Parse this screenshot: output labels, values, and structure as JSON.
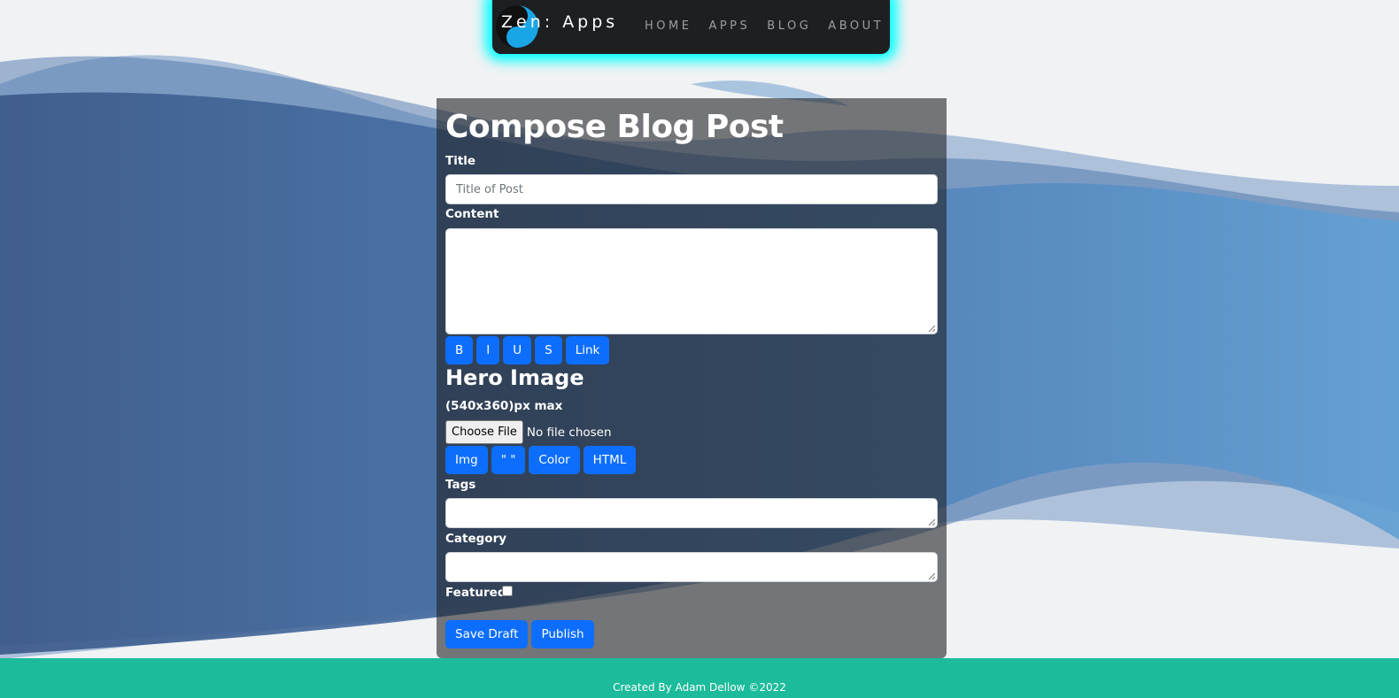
{
  "colors": {
    "page_bg": "#f0f2f4",
    "wave_dark": "#3c5b8c",
    "wave_light": "#5f96c9",
    "navbar_bg": "#1e1f21",
    "navbar_glow": "#00ffff",
    "panel_bg": "rgba(32,34,37,0.6)",
    "button_primary": "#0d6efd",
    "footer_bg": "#1cbb9b"
  },
  "navbar": {
    "brand": "Zen: Apps",
    "logo_icon": "yin-yang-icon",
    "links": [
      "HOME",
      "APPS",
      "BLOG",
      "ABOUT"
    ]
  },
  "form": {
    "heading": "Compose Blog Post",
    "title_label": "Title",
    "title_placeholder": "Title of Post",
    "content_label": "Content",
    "format_buttons": [
      "B",
      "I",
      "U",
      "S",
      "Link"
    ],
    "hero_heading": "Hero Image",
    "hero_size_note": "(540x360)px max",
    "file_button": "Choose File",
    "file_status": "No file chosen",
    "insert_buttons": [
      "Img",
      "\" \"",
      "Color",
      "HTML"
    ],
    "tags_label": "Tags",
    "category_label": "Category",
    "featured_label": "Featured",
    "save_draft_label": "Save Draft",
    "publish_label": "Publish"
  },
  "footer": {
    "text": "Created By Adam Dellow ©2022"
  }
}
